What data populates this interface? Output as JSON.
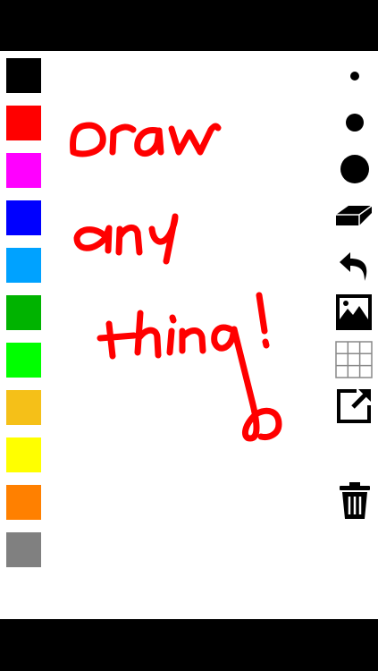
{
  "palette": {
    "colors": [
      {
        "name": "black",
        "hex": "#000000"
      },
      {
        "name": "red",
        "hex": "#ff0000"
      },
      {
        "name": "magenta",
        "hex": "#ff00ff"
      },
      {
        "name": "blue",
        "hex": "#0000ff"
      },
      {
        "name": "sky-blue",
        "hex": "#00a2ff"
      },
      {
        "name": "dark-green",
        "hex": "#00b300"
      },
      {
        "name": "green",
        "hex": "#00ff00"
      },
      {
        "name": "amber",
        "hex": "#f5c018"
      },
      {
        "name": "yellow",
        "hex": "#ffff00"
      },
      {
        "name": "orange",
        "hex": "#ff8000"
      },
      {
        "name": "gray",
        "hex": "#808080"
      }
    ]
  },
  "toolbar": {
    "tools": [
      "brush-small-icon",
      "brush-medium-icon",
      "brush-large-icon",
      "eraser-icon",
      "undo-icon",
      "image-icon",
      "grid-icon",
      "share-icon",
      "trash-icon"
    ]
  },
  "drawing": {
    "stroke_color": "#ff0000",
    "words": [
      "draw",
      "any",
      "thing!"
    ]
  }
}
